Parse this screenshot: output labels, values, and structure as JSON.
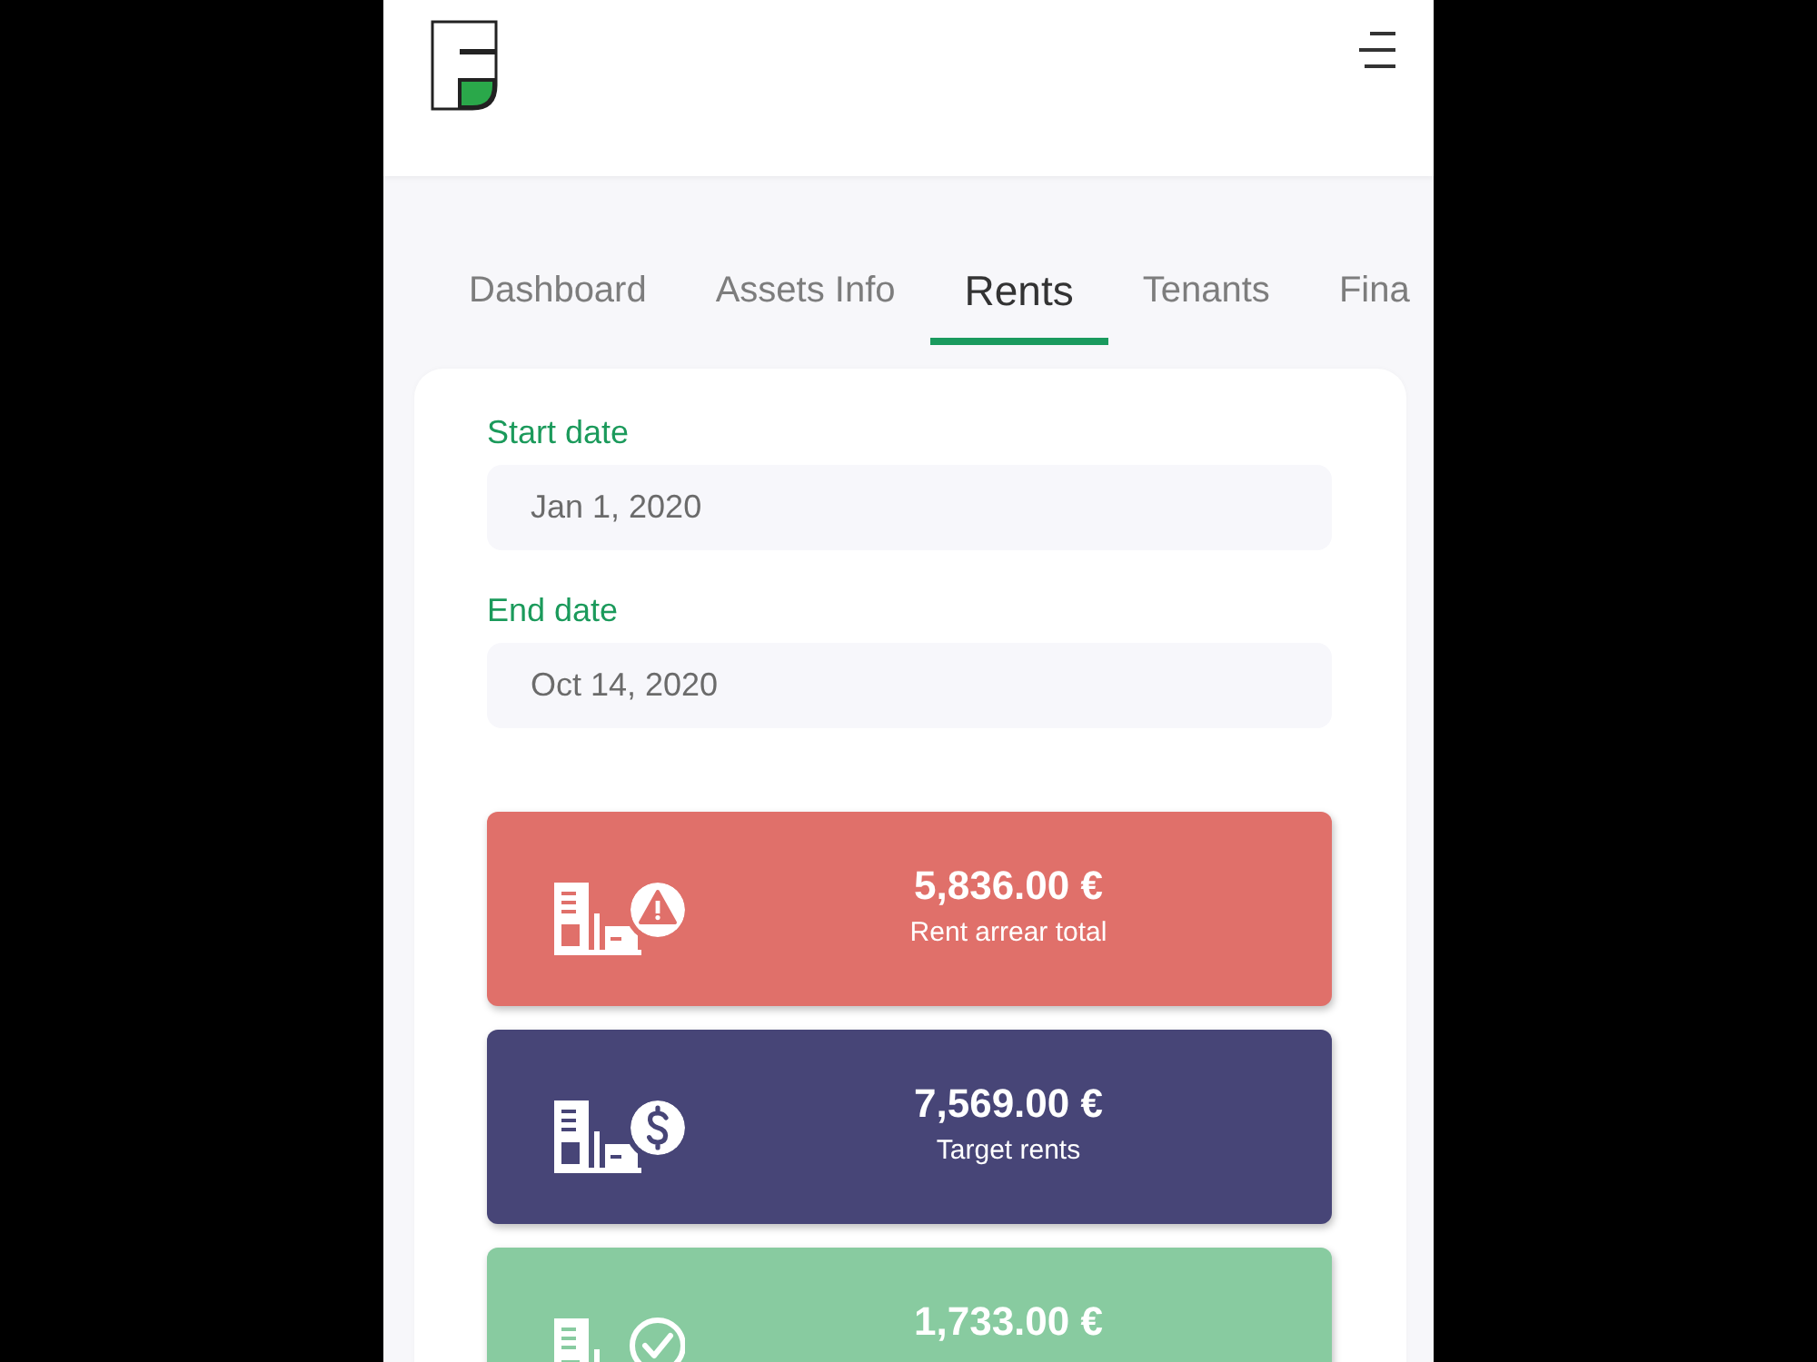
{
  "tabs": [
    {
      "label": "Dashboard",
      "selected": false
    },
    {
      "label": "Assets Info",
      "selected": false
    },
    {
      "label": "Rents",
      "selected": true
    },
    {
      "label": "Tenants",
      "selected": false
    },
    {
      "label": "Fina",
      "selected": false
    }
  ],
  "filters": [
    {
      "label": "Start date",
      "value": "Jan 1, 2020"
    },
    {
      "label": "End date",
      "value": "Oct 14, 2020"
    }
  ],
  "stats": [
    {
      "kind": "arrears",
      "value": "5,836.00 €",
      "label": "Rent arrear total",
      "color": "#e0706a"
    },
    {
      "kind": "target",
      "value": "7,569.00 €",
      "label": "Target rents",
      "color": "#474577"
    },
    {
      "kind": "collected",
      "value": "1,733.00 €",
      "color": "#88cba0"
    }
  ]
}
